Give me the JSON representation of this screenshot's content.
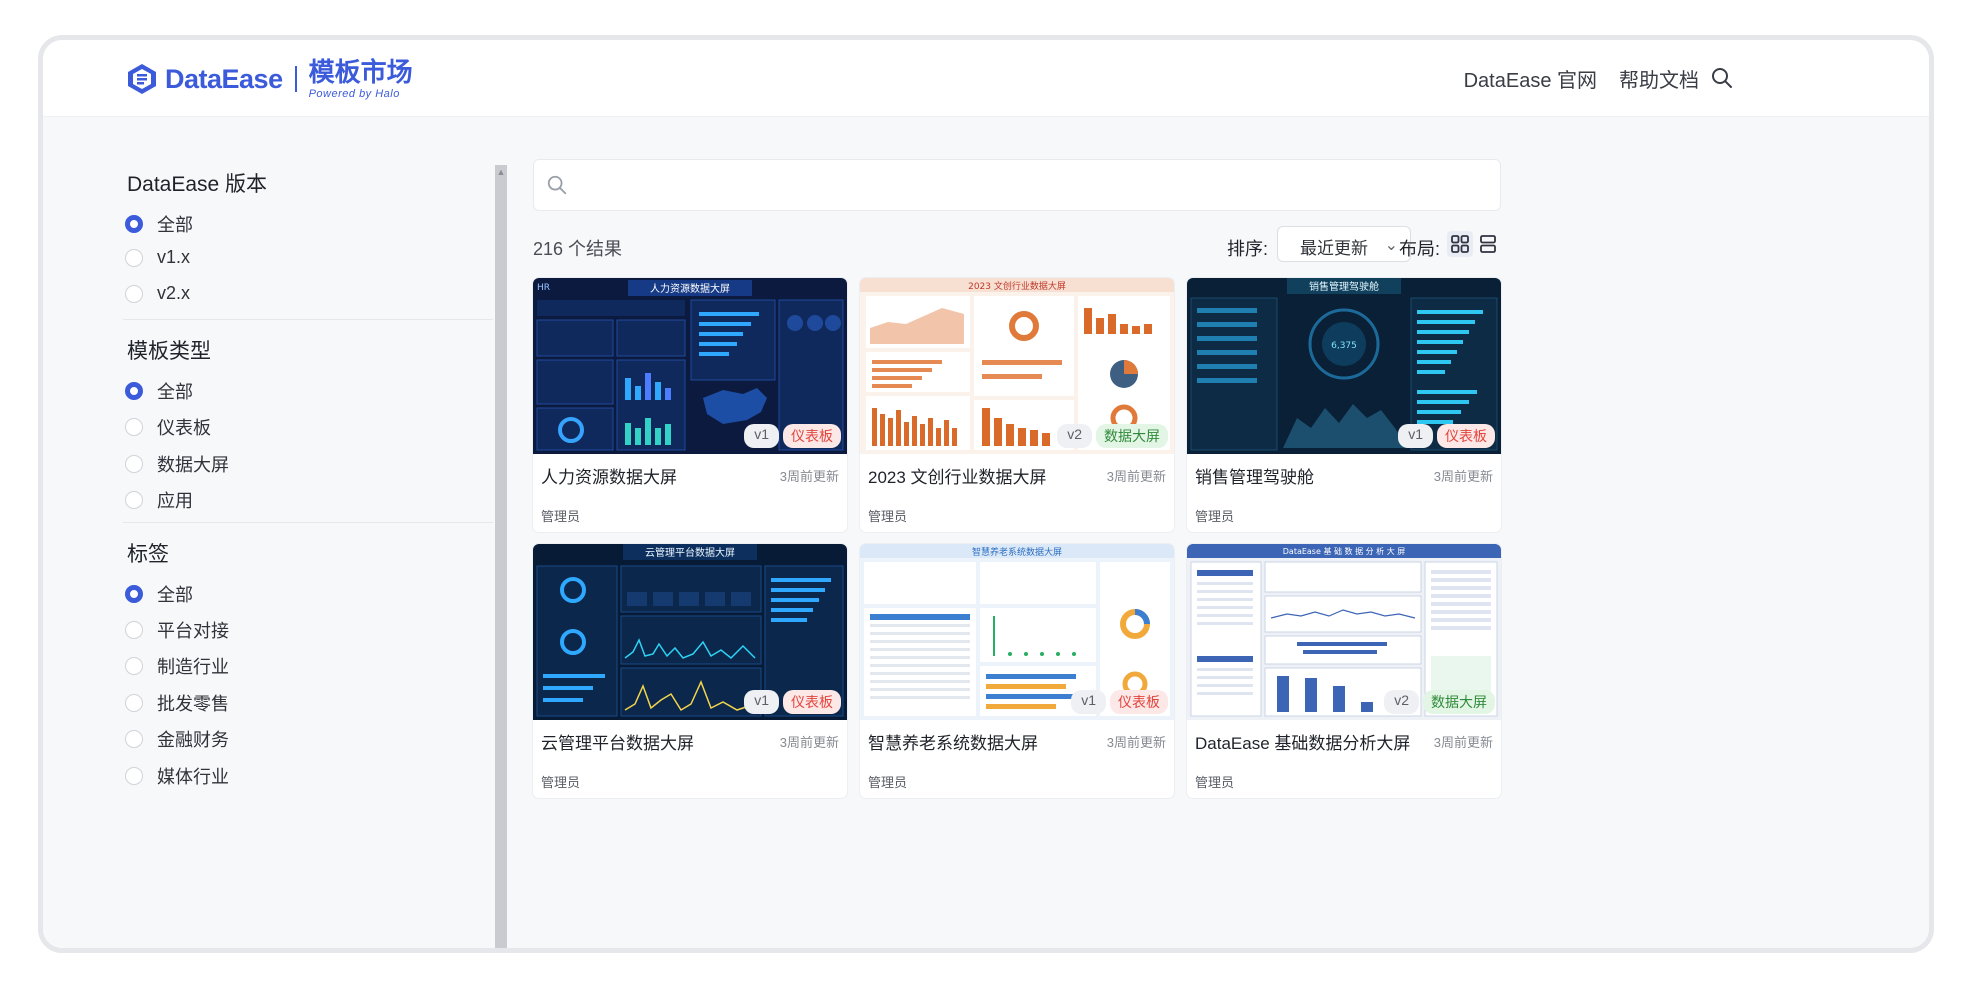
{
  "header": {
    "brand": "DataEase",
    "market_title": "模板市场",
    "market_sub": "Powered by Halo",
    "nav": [
      "DataEase 官网",
      "帮助文档"
    ]
  },
  "sidebar": {
    "groups": [
      {
        "title": "DataEase 版本",
        "options": [
          "全部",
          "v1.x",
          "v2.x"
        ],
        "selected": 0
      },
      {
        "title": "模板类型",
        "options": [
          "全部",
          "仪表板",
          "数据大屏",
          "应用"
        ],
        "selected": 0
      },
      {
        "title": "标签",
        "options": [
          "全部",
          "平台对接",
          "制造行业",
          "批发零售",
          "金融财务",
          "媒体行业"
        ],
        "selected": 0
      }
    ]
  },
  "toolbar": {
    "search_placeholder": "",
    "result_count": "216 个结果",
    "sort_label": "排序:",
    "sort_value": "最近更新",
    "layout_label": "布局:"
  },
  "cards": [
    {
      "title": "人力资源数据大屏",
      "time": "3周前更新",
      "author": "管理员",
      "version": "v1",
      "type": "仪表板",
      "type_kind": "dash",
      "theme": "dark-blue"
    },
    {
      "title": "2023 文创行业数据大屏",
      "time": "3周前更新",
      "author": "管理员",
      "version": "v2",
      "type": "数据大屏",
      "type_kind": "screen",
      "theme": "warm"
    },
    {
      "title": "销售管理驾驶舱",
      "time": "3周前更新",
      "author": "管理员",
      "version": "v1",
      "type": "仪表板",
      "type_kind": "dash",
      "theme": "dark-teal"
    },
    {
      "title": "云管理平台数据大屏",
      "time": "3周前更新",
      "author": "管理员",
      "version": "v1",
      "type": "仪表板",
      "type_kind": "dash",
      "theme": "dark-navy"
    },
    {
      "title": "智慧养老系统数据大屏",
      "time": "3周前更新",
      "author": "管理员",
      "version": "v1",
      "type": "仪表板",
      "type_kind": "dash",
      "theme": "light-blue"
    },
    {
      "title": "DataEase 基础数据分析大屏",
      "time": "3周前更新",
      "author": "管理员",
      "version": "v2",
      "type": "数据大屏",
      "type_kind": "screen",
      "theme": "light-gray"
    }
  ],
  "thumb_text": {
    "t0": "人力资源数据大屏",
    "t1": "2023 文创行业数据大屏",
    "t2": "销售管理驾驶舱",
    "t3": "云管理平台数据大屏",
    "t4": "智慧养老系统数据大屏",
    "t5": "DataEase 基 础 数 据 分 析 大 屏"
  },
  "colors": {
    "accent": "#3b5bdb",
    "dash_badge": "#e2453c",
    "screen_badge": "#2f8a3b"
  }
}
